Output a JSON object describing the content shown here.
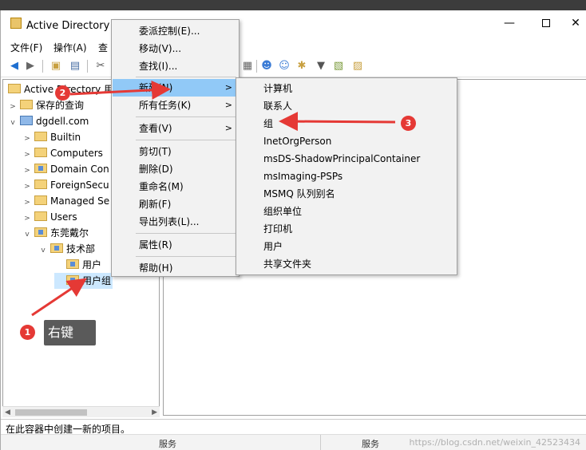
{
  "window": {
    "title": "Active Directory 用",
    "minimize": "—",
    "close": "✕"
  },
  "menubar": {
    "items": [
      "文件(F)",
      "操作(A)",
      "查"
    ]
  },
  "toolbar": {
    "icons": [
      "back-icon",
      "forward-icon",
      "folder-up-icon",
      "console-tree-icon",
      "cut-icon",
      "user-icon",
      "users-icon",
      "group-add-icon",
      "filter-icon",
      "properties-icon",
      "refresh-icon"
    ]
  },
  "tree": {
    "root": "Active Directory 用",
    "items": [
      {
        "label": "保存的查询",
        "expander": ">"
      },
      {
        "label": "dgdell.com",
        "expander": "v"
      },
      {
        "label": "Builtin",
        "expander": ">"
      },
      {
        "label": "Computers",
        "expander": ">"
      },
      {
        "label": "Domain Con",
        "expander": ">"
      },
      {
        "label": "ForeignSecu",
        "expander": ">"
      },
      {
        "label": "Managed Se",
        "expander": ">"
      },
      {
        "label": "Users",
        "expander": ">"
      },
      {
        "label": "东莞戴尔",
        "expander": "v"
      },
      {
        "label": "技术部",
        "expander": "v"
      },
      {
        "label": "用户",
        "expander": ""
      },
      {
        "label": "用户组",
        "expander": ""
      }
    ]
  },
  "context_menu": {
    "items": [
      {
        "label": "委派控制(E)...",
        "arrow": ""
      },
      {
        "label": "移动(V)...",
        "arrow": ""
      },
      {
        "label": "查找(I)...",
        "arrow": ""
      },
      {
        "label": "新建(N)",
        "arrow": ">"
      },
      {
        "label": "所有任务(K)",
        "arrow": ">"
      },
      {
        "label": "查看(V)",
        "arrow": ">"
      },
      {
        "label": "剪切(T)",
        "arrow": ""
      },
      {
        "label": "删除(D)",
        "arrow": ""
      },
      {
        "label": "重命名(M)",
        "arrow": ""
      },
      {
        "label": "刷新(F)",
        "arrow": ""
      },
      {
        "label": "导出列表(L)...",
        "arrow": ""
      },
      {
        "label": "属性(R)",
        "arrow": ""
      },
      {
        "label": "帮助(H)",
        "arrow": ""
      }
    ]
  },
  "submenu": {
    "items": [
      "计算机",
      "联系人",
      "组",
      "InetOrgPerson",
      "msDS-ShadowPrincipalContainer",
      "msImaging-PSPs",
      "MSMQ 队列别名",
      "组织单位",
      "打印机",
      "用户",
      "共享文件夹"
    ]
  },
  "annotations": {
    "badge1": "1",
    "badge2": "2",
    "badge3": "3",
    "callout": "右键",
    "color": "#e53935"
  },
  "status": {
    "text": "在此容器中创建一新的项目。"
  },
  "footer": {
    "left": "服务",
    "right": "服务",
    "watermark": "https://blog.csdn.net/weixin_42523434"
  }
}
